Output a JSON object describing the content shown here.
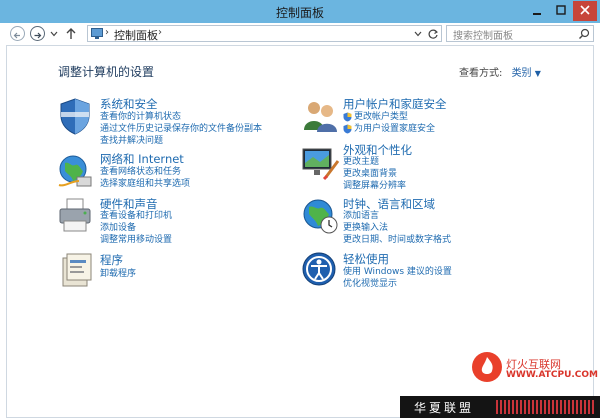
{
  "window": {
    "title": "控制面板"
  },
  "address_bar": {
    "path": "控制面板",
    "search_placeholder": "搜索控制面板"
  },
  "panel": {
    "heading": "调整计算机的设置",
    "view_by_label": "查看方式:",
    "view_by_value": "类别"
  },
  "categories": {
    "system": {
      "title": "系统和安全",
      "links": [
        "查看你的计算机状态",
        "通过文件历史记录保存你的文件备份副本",
        "查找并解决问题"
      ]
    },
    "network": {
      "title": "网络和 Internet",
      "links": [
        "查看网络状态和任务",
        "选择家庭组和共享选项"
      ]
    },
    "hardware": {
      "title": "硬件和声音",
      "links": [
        "查看设备和打印机",
        "添加设备",
        "调整常用移动设置"
      ]
    },
    "programs": {
      "title": "程序",
      "links": [
        "卸载程序"
      ]
    },
    "users": {
      "title": "用户帐户和家庭安全",
      "links": [
        "更改帐户类型",
        "为用户设置家庭安全"
      ]
    },
    "appearance": {
      "title": "外观和个性化",
      "links": [
        "更改主题",
        "更改桌面背景",
        "调整屏幕分辨率"
      ]
    },
    "clock": {
      "title": "时钟、语言和区域",
      "links": [
        "添加语言",
        "更换输入法",
        "更改日期、时间或数字格式"
      ]
    },
    "ease": {
      "title": "轻松使用",
      "links": [
        "使用 Windows 建议的设置",
        "优化视觉显示"
      ]
    }
  },
  "watermark": {
    "brand_cn": "灯火互联网",
    "brand_url": "WWW.ATCPU.COM"
  },
  "bottom_bar": {
    "site": "华夏联盟"
  }
}
